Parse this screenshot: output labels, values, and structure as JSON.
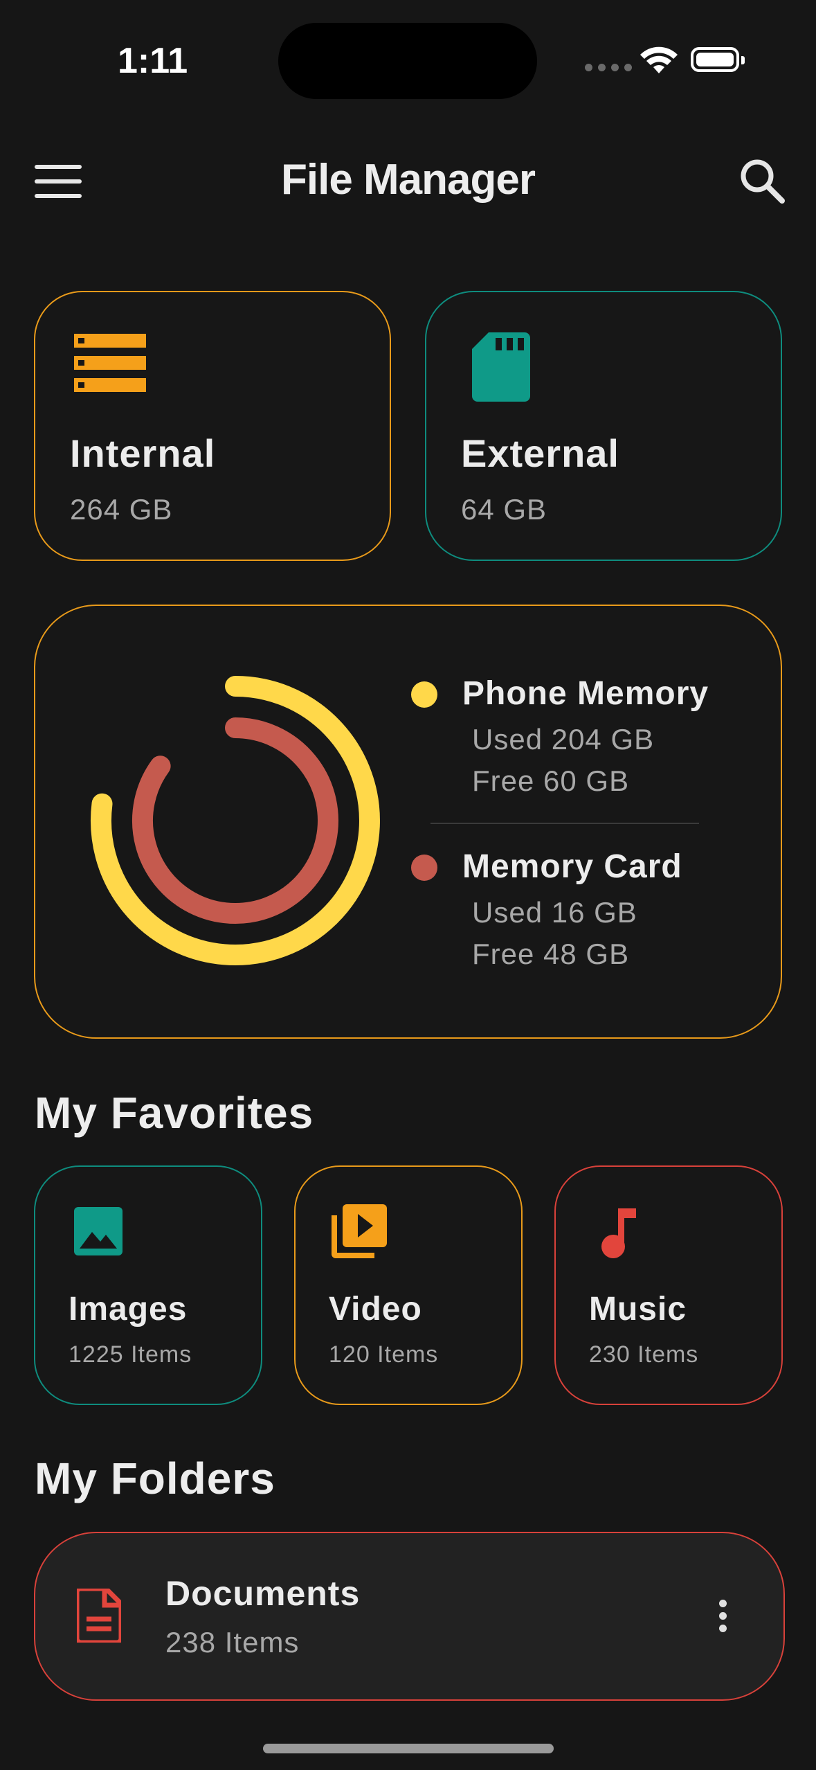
{
  "status_bar": {
    "time": "1:11"
  },
  "header": {
    "title": "File Manager",
    "menu_icon": "hamburger-menu-icon",
    "search_icon": "search-icon"
  },
  "storage": [
    {
      "name": "Internal",
      "size": "264 GB",
      "icon": "server-storage-icon",
      "accent": "#E89A1A"
    },
    {
      "name": "External",
      "size": "64 GB",
      "icon": "sd-card-icon",
      "accent": "#0E8C7E"
    }
  ],
  "memory": {
    "phone": {
      "label": "Phone Memory",
      "used": "Used 204 GB",
      "free": "Free 60 GB",
      "color": "#FFD84A",
      "used_fraction": 0.77
    },
    "card": {
      "label": "Memory Card",
      "used": "Used 16 GB",
      "free": "Free 48 GB",
      "color": "#C55A4E",
      "used_fraction": 0.85
    }
  },
  "favorites": {
    "title": "My Favorites",
    "items": [
      {
        "name": "Images",
        "count": "1225 Items",
        "icon": "image-icon",
        "accent": "#0E8C7E"
      },
      {
        "name": "Video",
        "count": "120 Items",
        "icon": "video-library-icon",
        "accent": "#E89A1A"
      },
      {
        "name": "Music",
        "count": "230 Items",
        "icon": "music-note-icon",
        "accent": "#E2453C"
      }
    ]
  },
  "folders": {
    "title": "My Folders",
    "items": [
      {
        "name": "Documents",
        "count": "238 Items",
        "icon": "document-icon",
        "accent": "#E2453C"
      }
    ]
  }
}
